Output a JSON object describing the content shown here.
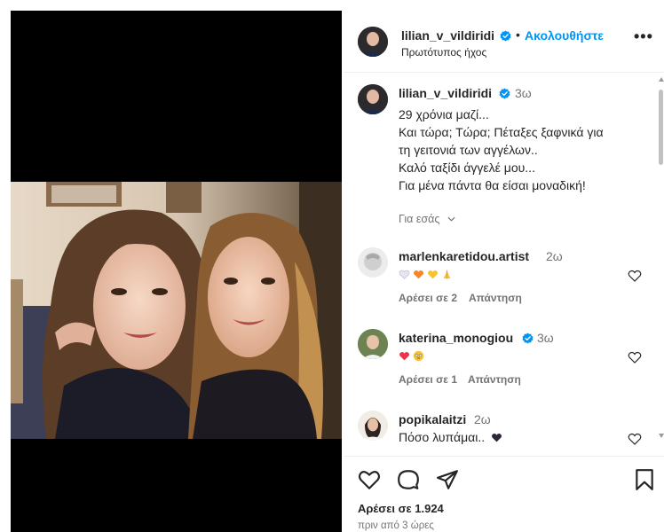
{
  "post": {
    "author": "lilian_v_vildiridi",
    "follow_label": "Ακολουθήστε",
    "separator": "•",
    "audio_label": "Πρωτότυπος ήχος",
    "more_label": "•••"
  },
  "caption": {
    "username": "lilian_v_vildiridi",
    "time": "3ω",
    "lines": [
      "29 χρόνια μαζί...",
      "Και τώρα; Τώρα; Πέταξες ξαφνικά για",
      "τη γειτονιά των αγγέλων..",
      "Καλό ταξίδι άγγελέ μου...",
      "Για μένα πάντα θα είσαι μοναδική!"
    ],
    "translation_label": "Για εσάς"
  },
  "comments": [
    {
      "username": "marlenkaretidou.artist",
      "time": "2ω",
      "text": "",
      "emojis": [
        "white-heart",
        "orange-heart",
        "yellow-heart",
        "praying-hands"
      ],
      "likes": "Αρέσει σε 2",
      "reply": "Απάντηση"
    },
    {
      "username": "katerina_monogiou",
      "time": "3ω",
      "text": "",
      "emojis": [
        "red-heart",
        "pleading-face"
      ],
      "likes": "Αρέσει σε 1",
      "reply": "Απάντηση"
    },
    {
      "username": "popikalaitzi",
      "time": "2ω",
      "text": "Πόσο λυπάμαι..",
      "emojis": [
        "purple-heart"
      ],
      "likes": "",
      "reply": ""
    }
  ],
  "footer": {
    "likes_text": "Αρέσει σε 1.924",
    "time_ago": "πριν από 3 ώρες"
  },
  "colors": {
    "follow_blue": "#0095f6",
    "verified_blue": "#0095f6",
    "secondary_text": "#737373"
  },
  "icons": [
    "heart-icon",
    "comment-icon",
    "share-icon",
    "bookmark-icon",
    "verified-badge-icon",
    "chevron-down-icon"
  ]
}
